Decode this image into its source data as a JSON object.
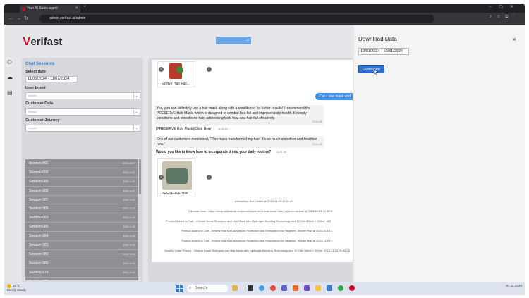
{
  "browser": {
    "tab_title": "Your AI Sales agent",
    "url": "admin.verifast.ai/admin"
  },
  "brand": {
    "logo_v": "V",
    "logo_rest": "erifast"
  },
  "filters": {
    "title": "Chat Sessions",
    "select_date_label": "Select date",
    "date_range": "11/05/2024 - 11/07/2024",
    "user_intent_label": "User Intent",
    "user_intent_placeholder": "Select...",
    "customer_data_label": "Customer Data",
    "customer_data_placeholder": "Select...",
    "customer_journey_label": "Customer Journey",
    "customer_journey_placeholder": "Select..."
  },
  "sessions": [
    {
      "label": "Session 991",
      "time": "2024-11-07"
    },
    {
      "label": "Session 990",
      "time": "2024-11-07"
    },
    {
      "label": "Session 989",
      "time": "2024-11-07"
    },
    {
      "label": "Session 988",
      "time": "2024-11-07"
    },
    {
      "label": "Session 987",
      "time": "2024-11-07"
    },
    {
      "label": "Session 986",
      "time": "2024-11-06"
    },
    {
      "label": "Session 983",
      "time": "2024-11-06"
    },
    {
      "label": "Session 985",
      "time": "2024-11-06"
    },
    {
      "label": "Session 984",
      "time": "2024-11-06"
    },
    {
      "label": "Session 981",
      "time": "2024-11-06"
    },
    {
      "label": "Session 982",
      "time": "2024-11-06"
    },
    {
      "label": "Session 980",
      "time": "2024-11-06"
    },
    {
      "label": "Session 979",
      "time": "2024-11-06"
    },
    {
      "label": "Session 978",
      "time": "2024-11-06"
    },
    {
      "label": "Session 976",
      "time": "2024-11-06"
    },
    {
      "label": "Session 977",
      "time": "2024-11-06"
    }
  ],
  "chat": {
    "card1_label": "Evorve Hair Fall...",
    "user_msg": "Can I use mask and",
    "bot_msg1": "Yes, you can definitely use a hair mask along with a conditioner for better results! I recommend the PRESERVE Hair Mask, which is designed to combat hair fall and improve scalp health. It deeply conditions and smoothens hair, addressing both frizz and hair fall effectively.",
    "bot_msg1_time": "11:01:45",
    "link_msg": "[PRESERVE Hair Mask](Click Here)",
    "link_time": "11:01:45",
    "bot_msg2": "One of our customers mentioned, \"This mask transformed my hair! It's so much smoother and healthier now.\"",
    "bot_msg2_time": "11:01:45",
    "bot_msg3": "Would you like to know how to incorporate it into your daily routine?",
    "bot_msg3_time": "11:01:45",
    "card2_label": "PRESERVE Hair...",
    "events": [
      "Interaction: Bot Closed at 2024-11-03 11:01:45",
      "Carousel click - https://shop.wildsature.co/products/preserve-hair-mask?utm_source=verifast at 2024-11-03 11:02:3",
      "Product Added to Cart - Volume Boost Shampoo and Hair Mask with Hydrogen Bonding Technology and 12 Oils 300ml + 200ml, at 2",
      "Product Added to Cart - Renew Hair Mist-Advanced Protection and Restoration for Healthier, Shinier Hair at 2024-11-03 1",
      "Product Added to Cart - Renew Hair Mist-Advanced Protection and Restoration for Healthier, Shinier Hair at 2024-11-03 1",
      "Shopify Order Placed - Volume Boost Shampoo and Hair Mask with Hydrogen Bonding Technology and 12 Oils 300ml + 200ml, 2024-11-03 20:45:15"
    ]
  },
  "download": {
    "title": "Download Data",
    "close": "×",
    "range": "10/01/2024 - 10/31/2024",
    "button": "Download"
  },
  "taskbar": {
    "temp": "29°C",
    "weather": "Mostly cloudy",
    "search": "Search",
    "time": "07-11-2024"
  },
  "colors": {
    "accent": "#3d8ee6",
    "brand": "#c8102e",
    "button": "#2f6fd0"
  }
}
